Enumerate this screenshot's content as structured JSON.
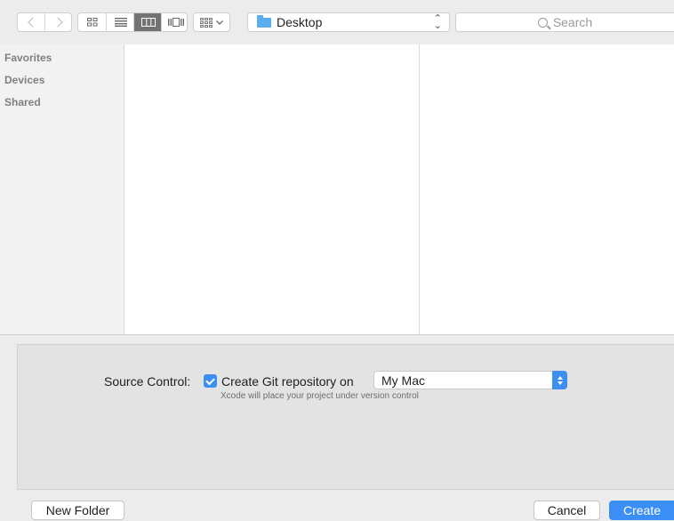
{
  "toolbar": {
    "path_label": "Desktop",
    "search_placeholder": "Search"
  },
  "sidebar": {
    "sections": [
      "Favorites",
      "Devices",
      "Shared"
    ]
  },
  "options": {
    "source_control_label": "Source Control:",
    "create_git_label": "Create Git repository on",
    "create_git_checked": true,
    "location_value": "My Mac",
    "hint": "Xcode will place your project under version control"
  },
  "buttons": {
    "new_folder": "New Folder",
    "cancel": "Cancel",
    "create": "Create"
  },
  "colors": {
    "accent": "#3b8ef3",
    "folder": "#5aaef0"
  }
}
